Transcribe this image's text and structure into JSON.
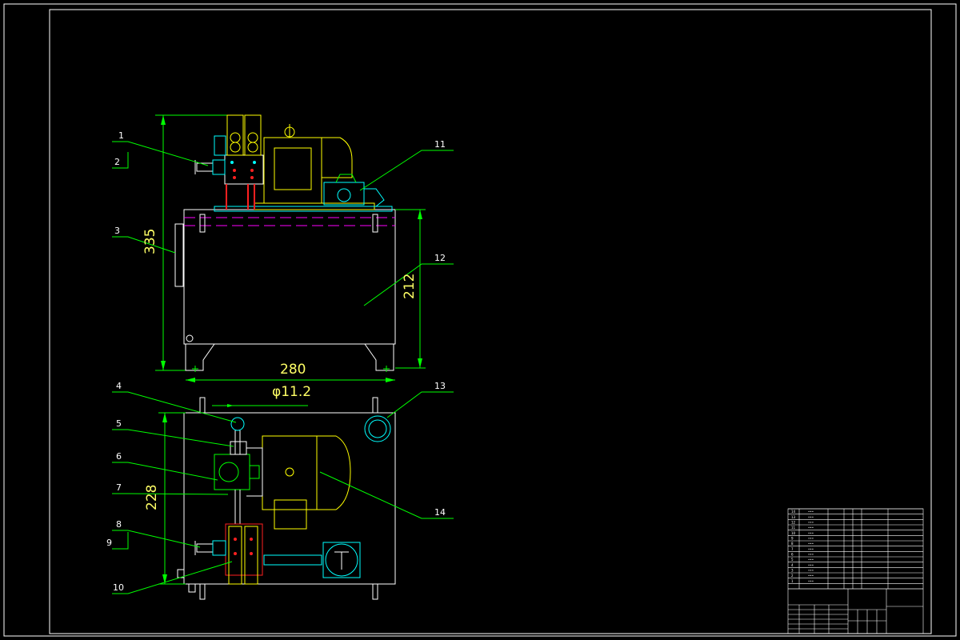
{
  "drawing": {
    "background": "#000000",
    "part_labels": [
      "1",
      "2",
      "3",
      "4",
      "5",
      "6",
      "7",
      "8",
      "9",
      "10",
      "11",
      "12",
      "13",
      "14"
    ],
    "dimensions": {
      "front_height": "335",
      "tank_height": "212",
      "width": "280",
      "diameter": "φ11.2",
      "top_depth": "228"
    }
  },
  "title_block": {
    "bom_rows": [
      "14",
      "13",
      "12",
      "11",
      "10",
      "9",
      "8",
      "7",
      "6",
      "5",
      "4",
      "3",
      "2",
      "1"
    ],
    "cell_text": "•••"
  },
  "colors": {
    "outline": "#ffffff",
    "dimension": "#00ff00",
    "dim_text": "#ffff66",
    "cyan": "#00ffff",
    "yellow": "#ffff00",
    "red": "#ff2020",
    "magenta": "#ff00ff"
  }
}
